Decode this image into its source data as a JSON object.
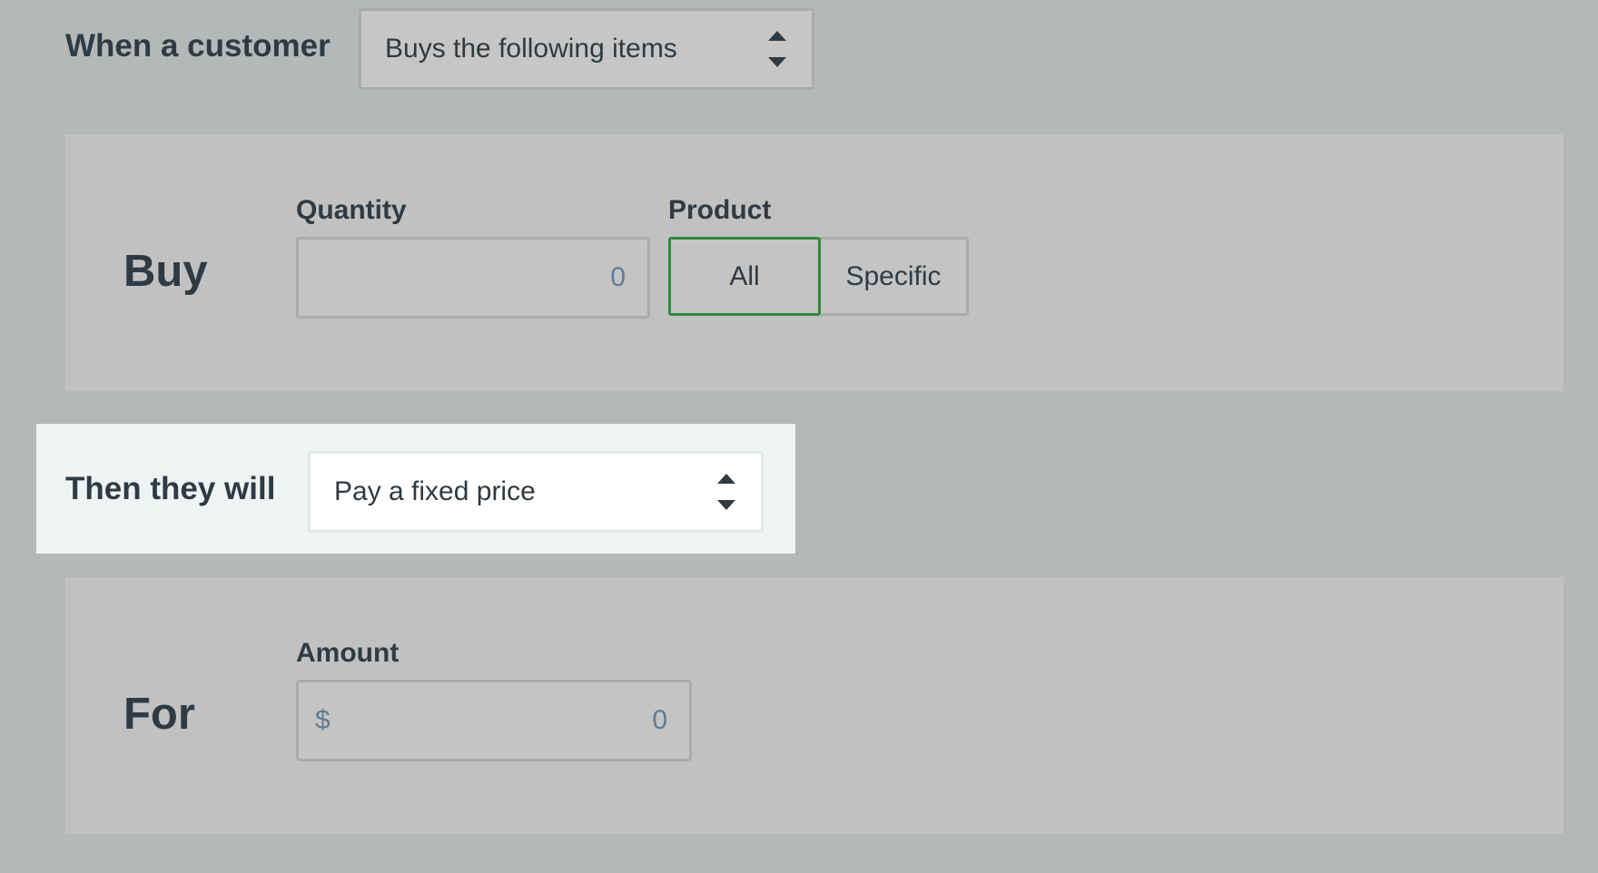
{
  "condition": {
    "label": "When a customer",
    "select_value": "Buys the following items"
  },
  "buy": {
    "title": "Buy",
    "quantity_label": "Quantity",
    "quantity_value": "0",
    "product_label": "Product",
    "product_options": [
      "All",
      "Specific"
    ],
    "product_selected": "All"
  },
  "action": {
    "label": "Then they will",
    "select_value": "Pay a fixed price"
  },
  "for": {
    "title": "For",
    "amount_label": "Amount",
    "currency_symbol": "$",
    "amount_value": "0"
  },
  "colors": {
    "background": "#b4b8b9",
    "panel": "#c1c1c1",
    "highlight": "#eff3f4",
    "accent_selected": "#2f8a3e",
    "input_text": "#5e7d94"
  },
  "icons": {
    "select_caret": "up-down-caret-icon"
  }
}
